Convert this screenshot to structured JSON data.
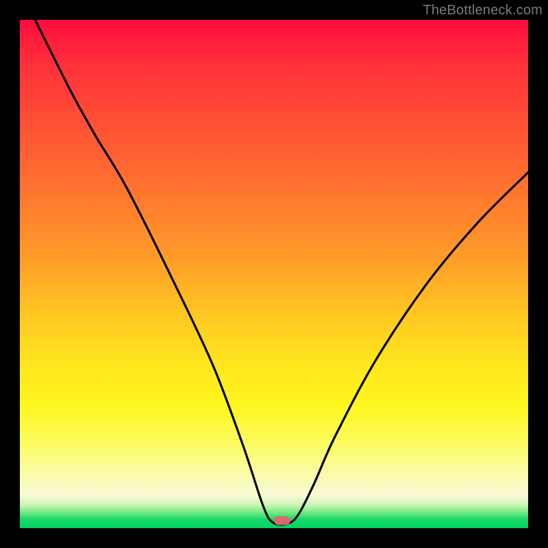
{
  "watermark": "TheBottleneck.com",
  "colors": {
    "frame_bg": "#000000",
    "curve_stroke": "#000000",
    "marker_fill": "#d86a6e"
  },
  "marker": {
    "x_frac": 0.516,
    "y_frac": 0.985
  },
  "chart_data": {
    "type": "line",
    "title": "",
    "xlabel": "",
    "ylabel": "",
    "xlim": [
      0,
      100
    ],
    "ylim": [
      0,
      100
    ],
    "series": [
      {
        "name": "bottleneck-curve",
        "x": [
          3,
          10,
          15,
          21,
          30,
          38,
          44,
          48,
          50,
          53,
          55,
          58,
          62,
          70,
          80,
          90,
          100
        ],
        "y": [
          100,
          86,
          77,
          67,
          49,
          32,
          16,
          4,
          1,
          1,
          3,
          9,
          18,
          33,
          48,
          60,
          70
        ]
      }
    ],
    "annotations": [
      {
        "type": "marker",
        "x": 51.6,
        "y": 1.5,
        "label": "optimal-point"
      }
    ],
    "background_gradient": {
      "orientation": "vertical",
      "stops": [
        {
          "pos": 0.0,
          "color": "#ff0a3e"
        },
        {
          "pos": 0.5,
          "color": "#ffc722"
        },
        {
          "pos": 0.8,
          "color": "#fff71f"
        },
        {
          "pos": 0.95,
          "color": "#c9f5b2"
        },
        {
          "pos": 1.0,
          "color": "#00d364"
        }
      ]
    }
  }
}
